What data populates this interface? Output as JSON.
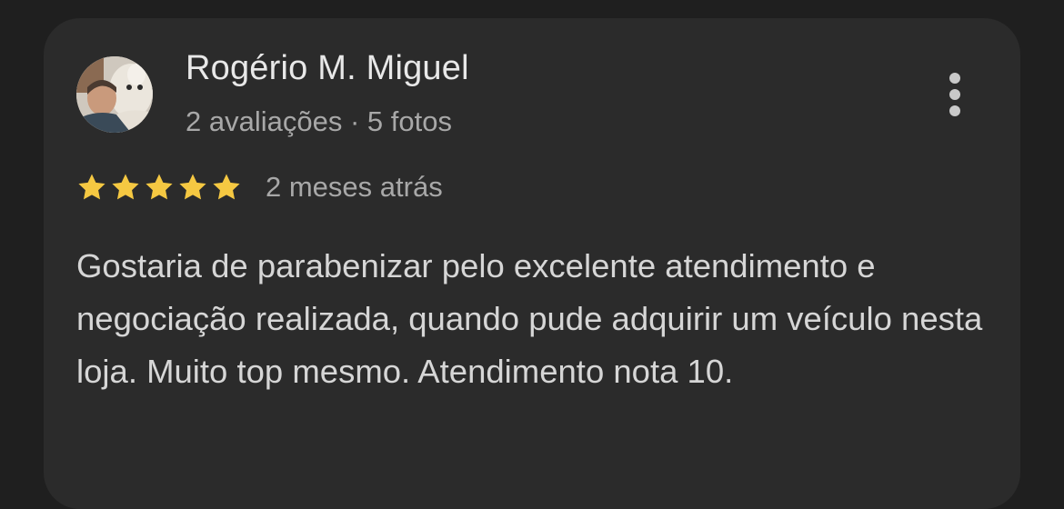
{
  "review": {
    "author_name": "Rogério M. Miguel",
    "author_meta": "2 avaliações · 5 fotos",
    "rating": 5,
    "rating_max": 5,
    "date": "2 meses atrás",
    "text": "Gostaria de parabenizar pelo excelente atendimento e negociação realizada, quando pude adquirir um veículo nesta loja. Muito top mesmo. Atendimento nota 10."
  },
  "icons": {
    "star": "star-icon",
    "menu": "more-vert-icon"
  },
  "colors": {
    "background": "#1f1f1f",
    "card": "#2b2b2b",
    "star": "#f5c842",
    "name": "#e8e8e8",
    "secondary": "#a8a8a8",
    "body": "#d6d6d6"
  }
}
